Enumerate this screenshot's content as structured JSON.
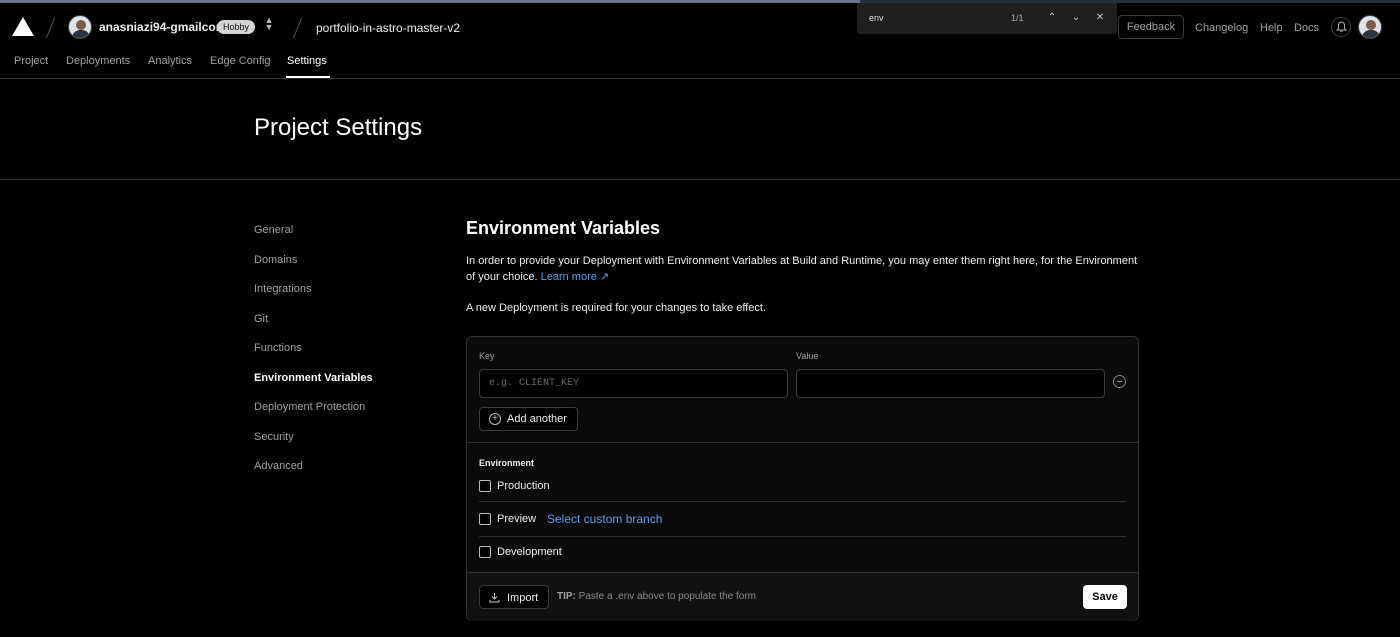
{
  "header": {
    "team_name": "anasniazi94-gmailcom",
    "plan_badge": "Hobby",
    "project_name": "portfolio-in-astro-master-v2",
    "feedback": "Feedback",
    "changelog": "Changelog",
    "help": "Help",
    "docs": "Docs"
  },
  "nav": {
    "tabs": [
      {
        "label": "Project"
      },
      {
        "label": "Deployments"
      },
      {
        "label": "Analytics"
      },
      {
        "label": "Edge Config"
      },
      {
        "label": "Settings",
        "active": true
      }
    ]
  },
  "find_bar": {
    "query": "env",
    "count": "1/1"
  },
  "page": {
    "title": "Project Settings"
  },
  "sidebar": {
    "items": [
      {
        "label": "General"
      },
      {
        "label": "Domains"
      },
      {
        "label": "Integrations"
      },
      {
        "label": "Git"
      },
      {
        "label": "Functions"
      },
      {
        "label": "Environment Variables",
        "active": true
      },
      {
        "label": "Deployment Protection"
      },
      {
        "label": "Security"
      },
      {
        "label": "Advanced"
      }
    ]
  },
  "env_vars": {
    "title": "Environment Variables",
    "description": "In order to provide your Deployment with Environment Variables at Build and Runtime, you may enter them right here, for the Environment of your choice.",
    "learn_more": "Learn more",
    "note": "A new Deployment is required for your changes to take effect.",
    "key_label": "Key",
    "key_placeholder": "e.g. CLIENT_KEY",
    "key_value": "",
    "value_label": "Value",
    "value_value": "",
    "add_another": "Add another",
    "environment_label": "Environment",
    "environments": [
      {
        "label": "Production",
        "checked": false
      },
      {
        "label": "Preview",
        "checked": false
      },
      {
        "label": "Development",
        "checked": false
      }
    ],
    "select_branch": "Select custom branch",
    "import": "Import",
    "tip_prefix": "TIP:",
    "tip_text": "Paste a .env above to populate the form",
    "save": "Save"
  },
  "colors": {
    "background": "#000000",
    "link": "#5b9df5",
    "border": "#333333"
  }
}
